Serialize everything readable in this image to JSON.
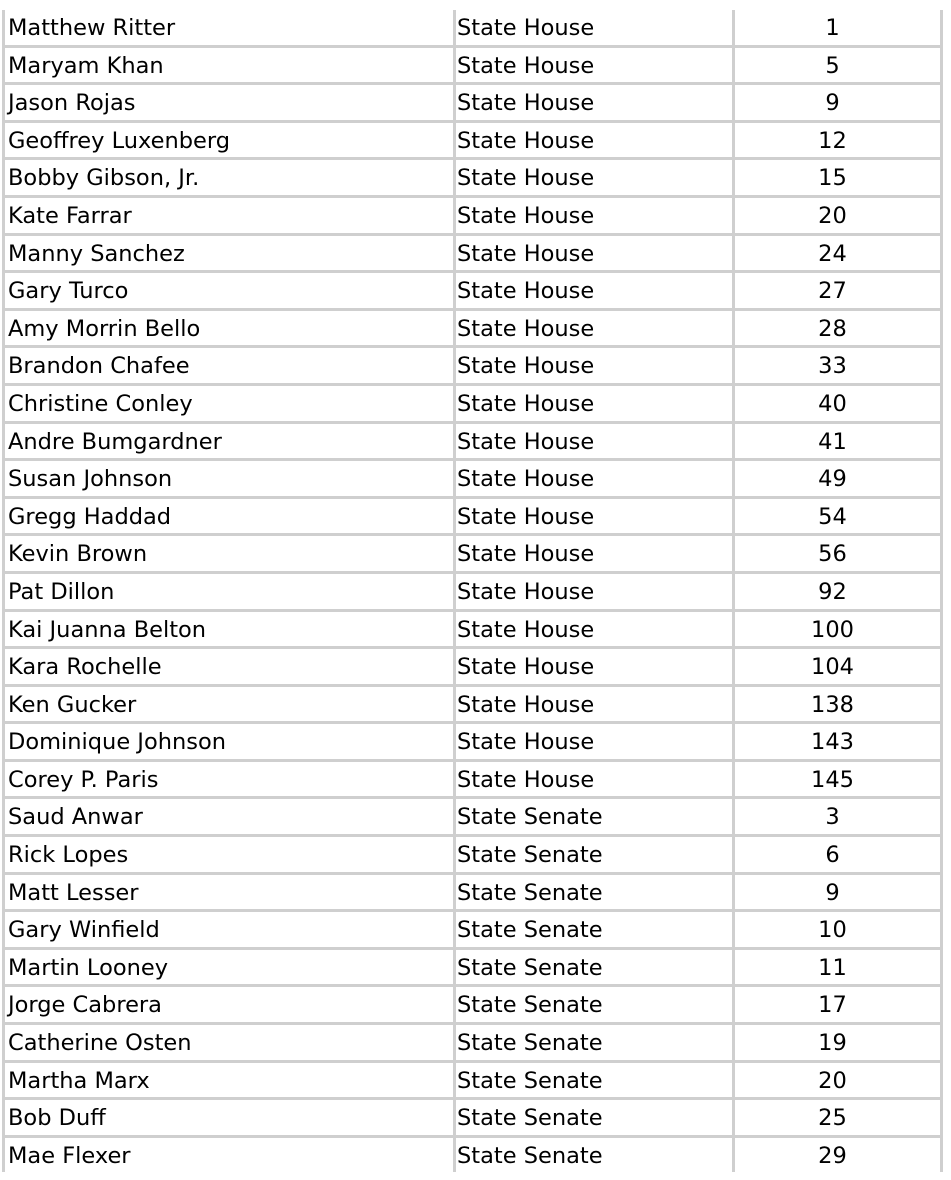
{
  "rows": [
    {
      "name": "Matthew Ritter",
      "chamber": "State House",
      "district": "1"
    },
    {
      "name": "Maryam Khan",
      "chamber": "State House",
      "district": "5"
    },
    {
      "name": "Jason Rojas",
      "chamber": "State House",
      "district": "9"
    },
    {
      "name": "Geoffrey Luxenberg",
      "chamber": "State House",
      "district": "12"
    },
    {
      "name": "Bobby Gibson, Jr.",
      "chamber": "State House",
      "district": "15"
    },
    {
      "name": "Kate Farrar",
      "chamber": "State House",
      "district": "20"
    },
    {
      "name": "Manny Sanchez",
      "chamber": "State House",
      "district": "24"
    },
    {
      "name": "Gary Turco",
      "chamber": "State House",
      "district": "27"
    },
    {
      "name": "Amy Morrin Bello",
      "chamber": "State House",
      "district": "28"
    },
    {
      "name": "Brandon Chafee",
      "chamber": "State House",
      "district": "33"
    },
    {
      "name": "Christine Conley",
      "chamber": "State House",
      "district": "40"
    },
    {
      "name": "Andre Bumgardner",
      "chamber": "State House",
      "district": "41"
    },
    {
      "name": "Susan Johnson",
      "chamber": "State House",
      "district": "49"
    },
    {
      "name": "Gregg Haddad",
      "chamber": "State House",
      "district": "54"
    },
    {
      "name": "Kevin Brown",
      "chamber": "State House",
      "district": "56"
    },
    {
      "name": "Pat Dillon",
      "chamber": "State House",
      "district": "92"
    },
    {
      "name": "Kai Juanna Belton",
      "chamber": "State House",
      "district": "100"
    },
    {
      "name": "Kara Rochelle",
      "chamber": "State House",
      "district": "104"
    },
    {
      "name": "Ken Gucker",
      "chamber": "State House",
      "district": "138"
    },
    {
      "name": "Dominique Johnson",
      "chamber": "State House",
      "district": "143"
    },
    {
      "name": "Corey P. Paris",
      "chamber": "State House",
      "district": "145"
    },
    {
      "name": "Saud Anwar",
      "chamber": "State Senate",
      "district": "3"
    },
    {
      "name": "Rick Lopes",
      "chamber": "State Senate",
      "district": "6"
    },
    {
      "name": "Matt Lesser",
      "chamber": "State Senate",
      "district": "9"
    },
    {
      "name": "Gary Winfield",
      "chamber": "State Senate",
      "district": "10"
    },
    {
      "name": "Martin Looney",
      "chamber": "State Senate",
      "district": "11"
    },
    {
      "name": "Jorge Cabrera",
      "chamber": "State Senate",
      "district": "17"
    },
    {
      "name": "Catherine Osten",
      "chamber": "State Senate",
      "district": "19"
    },
    {
      "name": "Martha Marx",
      "chamber": "State Senate",
      "district": "20"
    },
    {
      "name": "Bob Duff",
      "chamber": "State Senate",
      "district": "25"
    },
    {
      "name": "Mae Flexer",
      "chamber": "State Senate",
      "district": "29"
    }
  ]
}
